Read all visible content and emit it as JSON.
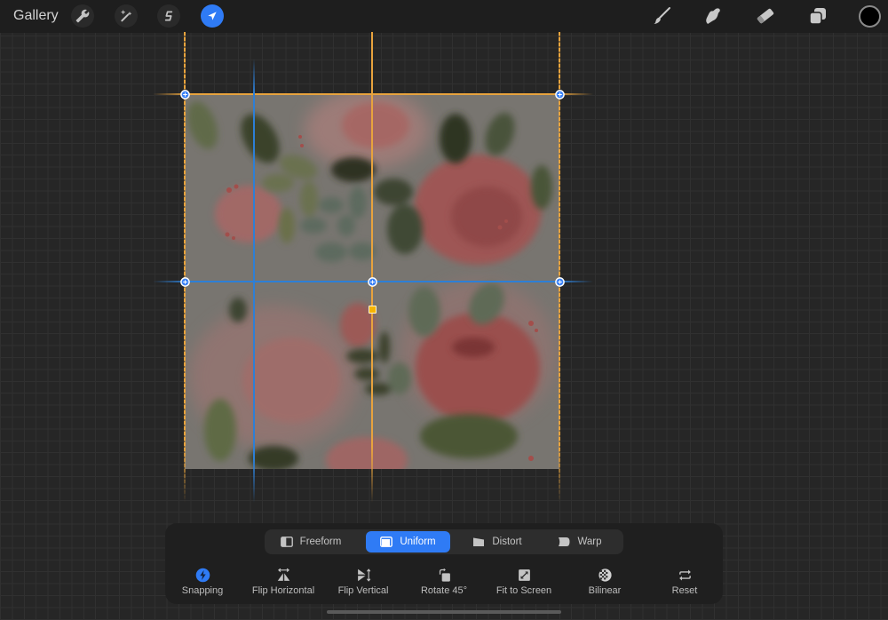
{
  "header": {
    "gallery_label": "Gallery",
    "left_tools": [
      {
        "id": "actions",
        "icon": "wrench-icon",
        "active": false
      },
      {
        "id": "adjustments",
        "icon": "magic-wand-icon",
        "active": false
      },
      {
        "id": "selection",
        "icon": "selection-icon",
        "active": false
      },
      {
        "id": "transform",
        "icon": "transform-arrow-icon",
        "active": true
      }
    ],
    "right_tools": [
      {
        "id": "paint",
        "icon": "brush-icon"
      },
      {
        "id": "smudge",
        "icon": "smudge-icon"
      },
      {
        "id": "erase",
        "icon": "eraser-icon"
      },
      {
        "id": "layers",
        "icon": "layers-icon"
      },
      {
        "id": "colors",
        "icon": "color-swatch"
      }
    ],
    "current_color": "#000000"
  },
  "colors": {
    "accent": "#2f7bf5",
    "guide_orange": "#e8a33d",
    "guide_blue": "#2d7fd6",
    "rotation_handle": "#f5b400",
    "canvas_background": "#787570"
  },
  "transform": {
    "modes": [
      {
        "label": "Freeform",
        "icon": "freeform-icon",
        "selected": false
      },
      {
        "label": "Uniform",
        "icon": "uniform-icon",
        "selected": true
      },
      {
        "label": "Distort",
        "icon": "distort-icon",
        "selected": false
      },
      {
        "label": "Warp",
        "icon": "warp-icon",
        "selected": false
      }
    ],
    "actions": [
      {
        "label": "Snapping",
        "icon": "snapping-icon",
        "active": true
      },
      {
        "label": "Flip Horizontal",
        "icon": "flip-horizontal-icon",
        "active": false
      },
      {
        "label": "Flip Vertical",
        "icon": "flip-vertical-icon",
        "active": false
      },
      {
        "label": "Rotate 45°",
        "icon": "rotate-icon",
        "active": false
      },
      {
        "label": "Fit to Screen",
        "icon": "fit-to-screen-icon",
        "active": false
      },
      {
        "label": "Bilinear",
        "icon": "bilinear-icon",
        "active": false
      },
      {
        "label": "Reset",
        "icon": "reset-icon",
        "active": false
      }
    ]
  }
}
